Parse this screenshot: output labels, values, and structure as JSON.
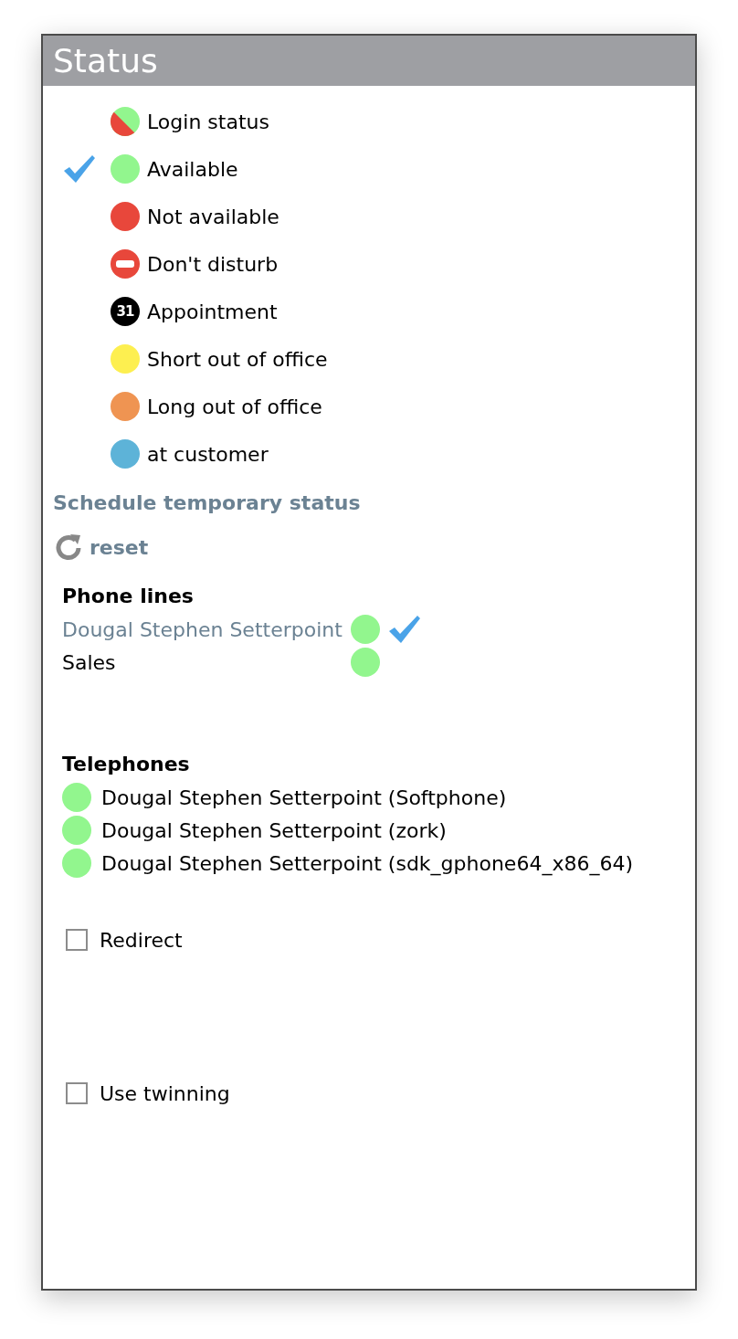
{
  "window": {
    "title": "Status"
  },
  "statuses": [
    {
      "kind": "split",
      "label": "Login status",
      "color": "#e8473b",
      "selected": false
    },
    {
      "kind": "dot",
      "label": "Available",
      "color": "#92f68e",
      "selected": true
    },
    {
      "kind": "dot",
      "label": "Not available",
      "color": "#e8473b",
      "selected": false
    },
    {
      "kind": "no-entry",
      "label": "Don't disturb",
      "color": "#e8473b",
      "selected": false
    },
    {
      "kind": "calendar",
      "label": "Appointment",
      "color": "#000000",
      "badge": "31",
      "selected": false
    },
    {
      "kind": "dot",
      "label": "Short out of office",
      "color": "#fdef50",
      "selected": false
    },
    {
      "kind": "dot",
      "label": "Long out of office",
      "color": "#ef9452",
      "selected": false
    },
    {
      "kind": "dot",
      "label": "at customer",
      "color": "#5db3d8",
      "selected": false
    }
  ],
  "schedule_link": "Schedule temporary status",
  "reset_button": {
    "label": "reset"
  },
  "phone_lines": {
    "title": "Phone lines",
    "items": [
      {
        "name": "Dougal Stephen Setterpoint",
        "color": "#92f68e",
        "selected": true
      },
      {
        "name": "Sales",
        "color": "#92f68e",
        "selected": false
      }
    ]
  },
  "telephones": {
    "title": "Telephones",
    "items": [
      {
        "name": "Dougal Stephen Setterpoint (Softphone)",
        "color": "#92f68e"
      },
      {
        "name": "Dougal Stephen Setterpoint (zork)",
        "color": "#92f68e"
      },
      {
        "name": "Dougal Stephen Setterpoint (sdk_gphone64_x86_64)",
        "color": "#92f68e"
      }
    ]
  },
  "options": [
    {
      "label": "Redirect",
      "checked": false
    },
    {
      "label": "Use twinning",
      "checked": false
    }
  ]
}
